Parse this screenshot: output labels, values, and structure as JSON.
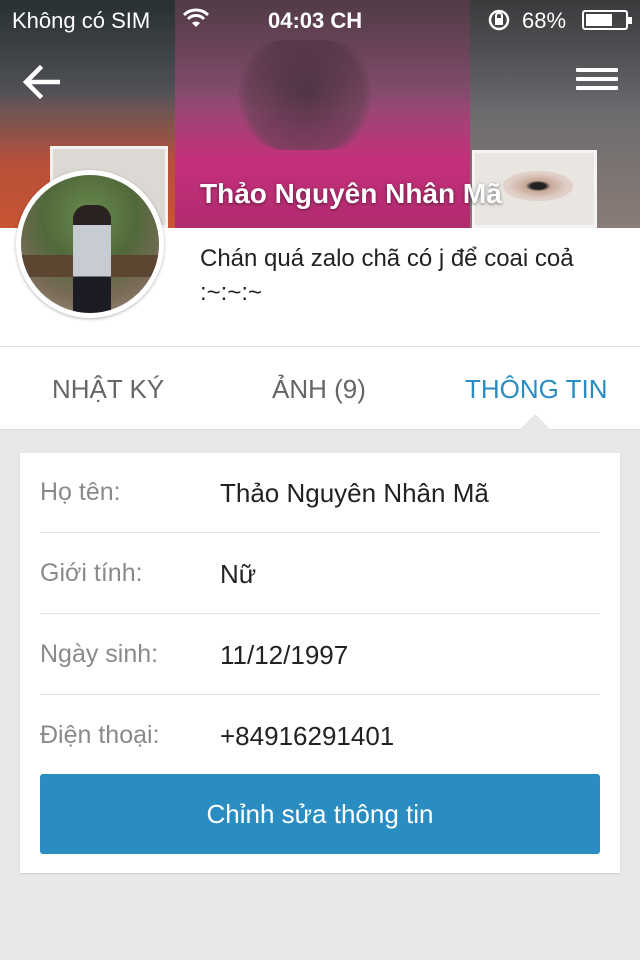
{
  "status_bar": {
    "carrier": "Không có SIM",
    "time": "04:03 CH",
    "battery_percent": "68%",
    "battery_level": 0.68,
    "wifi_icon": "wifi-icon",
    "lock_icon": "rotation-lock-icon"
  },
  "nav": {
    "back_icon": "back-arrow-icon",
    "menu_icon": "hamburger-menu-icon"
  },
  "profile": {
    "name": "Thảo Nguyên Nhân Mã",
    "status": "Chán quá zalo chã có j để coai coả :~:~:~"
  },
  "tabs": [
    {
      "label": "NHẬT KÝ",
      "active": false
    },
    {
      "label": "ẢNH (9)",
      "active": false
    },
    {
      "label": "THÔNG TIN",
      "active": true
    }
  ],
  "info": {
    "rows": [
      {
        "label": "Họ tên:",
        "value": "Thảo Nguyên Nhân Mã"
      },
      {
        "label": "Giới tính:",
        "value": "Nữ"
      },
      {
        "label": "Ngày sinh:",
        "value": "11/12/1997"
      },
      {
        "label": "Điện thoại:",
        "value": "+84916291401"
      }
    ],
    "edit_button": "Chỉnh sửa thông tin"
  },
  "colors": {
    "accent": "#2a8dc2",
    "background": "#e8e8e8"
  }
}
